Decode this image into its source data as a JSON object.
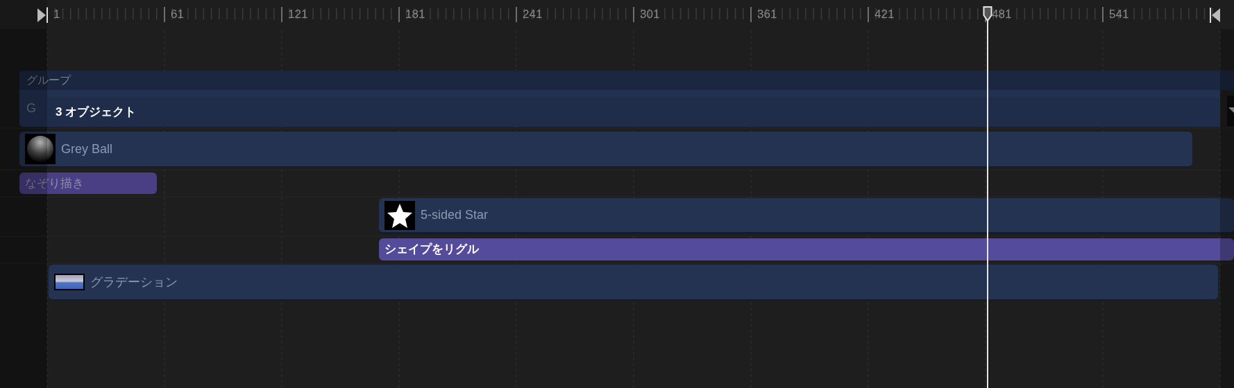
{
  "ruler": {
    "labels": [
      "1",
      "61",
      "121",
      "181",
      "241",
      "301",
      "361",
      "421",
      "481",
      "541"
    ]
  },
  "tracks": [
    {
      "kind": "group-header",
      "label": "グループ"
    },
    {
      "kind": "group",
      "badge": "G",
      "label": "3 オブジェクト",
      "selected": true
    },
    {
      "kind": "layer",
      "thumbnail": {
        "kind": "sphere"
      },
      "label": "Grey Ball"
    },
    {
      "kind": "behavior",
      "label": "なぞり描き",
      "selected": false
    },
    {
      "kind": "layer",
      "thumbnail": {
        "kind": "star"
      },
      "label": "5-sided Star"
    },
    {
      "kind": "behavior",
      "label": "シェイプをリグル",
      "selected": true
    },
    {
      "kind": "layer",
      "thumbnail": {
        "kind": "gradient"
      },
      "label": "グラデーション"
    }
  ]
}
